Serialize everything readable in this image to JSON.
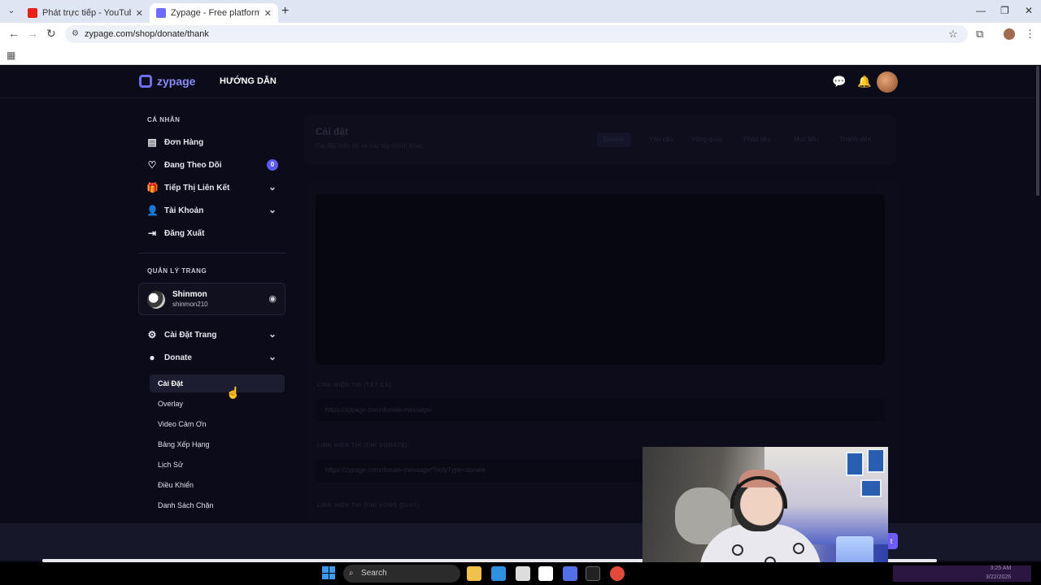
{
  "browser": {
    "tabs": [
      {
        "title": "Phát trực tiếp - YouTube Studio",
        "favicon_color": "#e62117"
      },
      {
        "title": "Zypage - Free platform for creators",
        "favicon_color": "#6d6cf2"
      }
    ],
    "url": "zypage.com/shop/donate/thank"
  },
  "header": {
    "logo": "zypage",
    "nav_guide": "HƯỚNG DẪN"
  },
  "sidebar": {
    "personal_title": "CÁ NHÂN",
    "personal_items": [
      {
        "label": "Đơn Hàng",
        "icon": "orders-icon"
      },
      {
        "label": "Đang Theo Dõi",
        "icon": "heart-icon",
        "badge": "0"
      },
      {
        "label": "Tiếp Thị Liên Kết",
        "icon": "gift-icon"
      },
      {
        "label": "Tài Khoản",
        "icon": "user-icon"
      },
      {
        "label": "Đăng Xuất",
        "icon": "logout-icon"
      }
    ],
    "manage_title": "QUẢN LÝ TRANG",
    "page_card": {
      "name": "Shinmon",
      "username": "shinmon210"
    },
    "manage_items": [
      {
        "label": "Cài Đặt Trang",
        "icon": "settings-icon"
      },
      {
        "label": "Donate",
        "icon": "donate-icon"
      }
    ],
    "donate_sub": [
      "Cài Đặt",
      "Overlay",
      "Video Cảm Ơn",
      "Bảng Xếp Hạng",
      "Lịch Sử",
      "Điều Khiển",
      "Danh Sách Chặn"
    ]
  },
  "content": {
    "title": "Cài đặt",
    "subtitle": "Cài đặt hiển thị và các tùy chỉnh khác",
    "tabs": [
      "Donate",
      "Yêu cầu",
      "Vòng quay",
      "Phần tiêu",
      "Mục tiêu",
      "Thành viên"
    ],
    "label_1": "LINK HIỂN THỊ (TẤT CẢ)",
    "url_1": "https://zypage.com/donate-message/",
    "label_2": "LINK HIỂN THỊ (CHỈ DONATE)",
    "url_2": "https://zypage.com/donate-message/?onlyType=donate",
    "label_3": "LINK HIỂN THỊ (CHỈ VÒNG QUAY)"
  },
  "taskbar": {
    "search_placeholder": "Search",
    "time": "3:25 AM",
    "date": "3/22/2026"
  },
  "colors": {
    "accent": "#6d6cf2",
    "page_bg": "#0b0b1a",
    "badge": "#5b5bf0"
  }
}
